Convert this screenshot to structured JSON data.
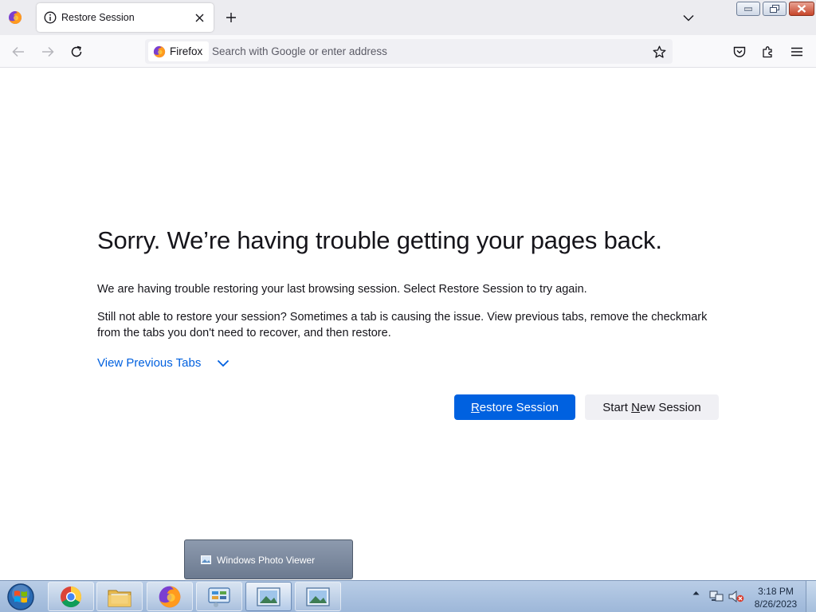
{
  "browser": {
    "tab": {
      "title": "Restore Session"
    },
    "identity_label": "Firefox",
    "url": {
      "placeholder": "Search with Google or enter address",
      "value": ""
    }
  },
  "page": {
    "headline": "Sorry. We’re having trouble getting your pages back.",
    "paragraph1": "We are having trouble restoring your last browsing session. Select Restore Session to try again.",
    "paragraph2": "Still not able to restore your session? Sometimes a tab is causing the issue. View previous tabs, remove the checkmark from the tabs you don't need to recover, and then restore.",
    "view_previous_tabs": "View Previous Tabs",
    "restore_button": {
      "accesskey": "R",
      "rest": "estore Session"
    },
    "new_session_button": {
      "before": "Start ",
      "accesskey": "N",
      "rest": "ew Session"
    }
  },
  "taskbar": {
    "preview_label": "Windows Photo Viewer",
    "clock": {
      "time": "3:18 PM",
      "date": "8/26/2023"
    },
    "pinned": [
      "chrome-icon",
      "file-explorer-icon",
      "firefox-icon",
      "control-panel-icon",
      "photo-viewer-icon",
      "photo-viewer-icon"
    ]
  },
  "colors": {
    "accent": "#0061e0",
    "link": "#0060df",
    "text": "#15141a",
    "taskbar": "#a9c1df"
  }
}
